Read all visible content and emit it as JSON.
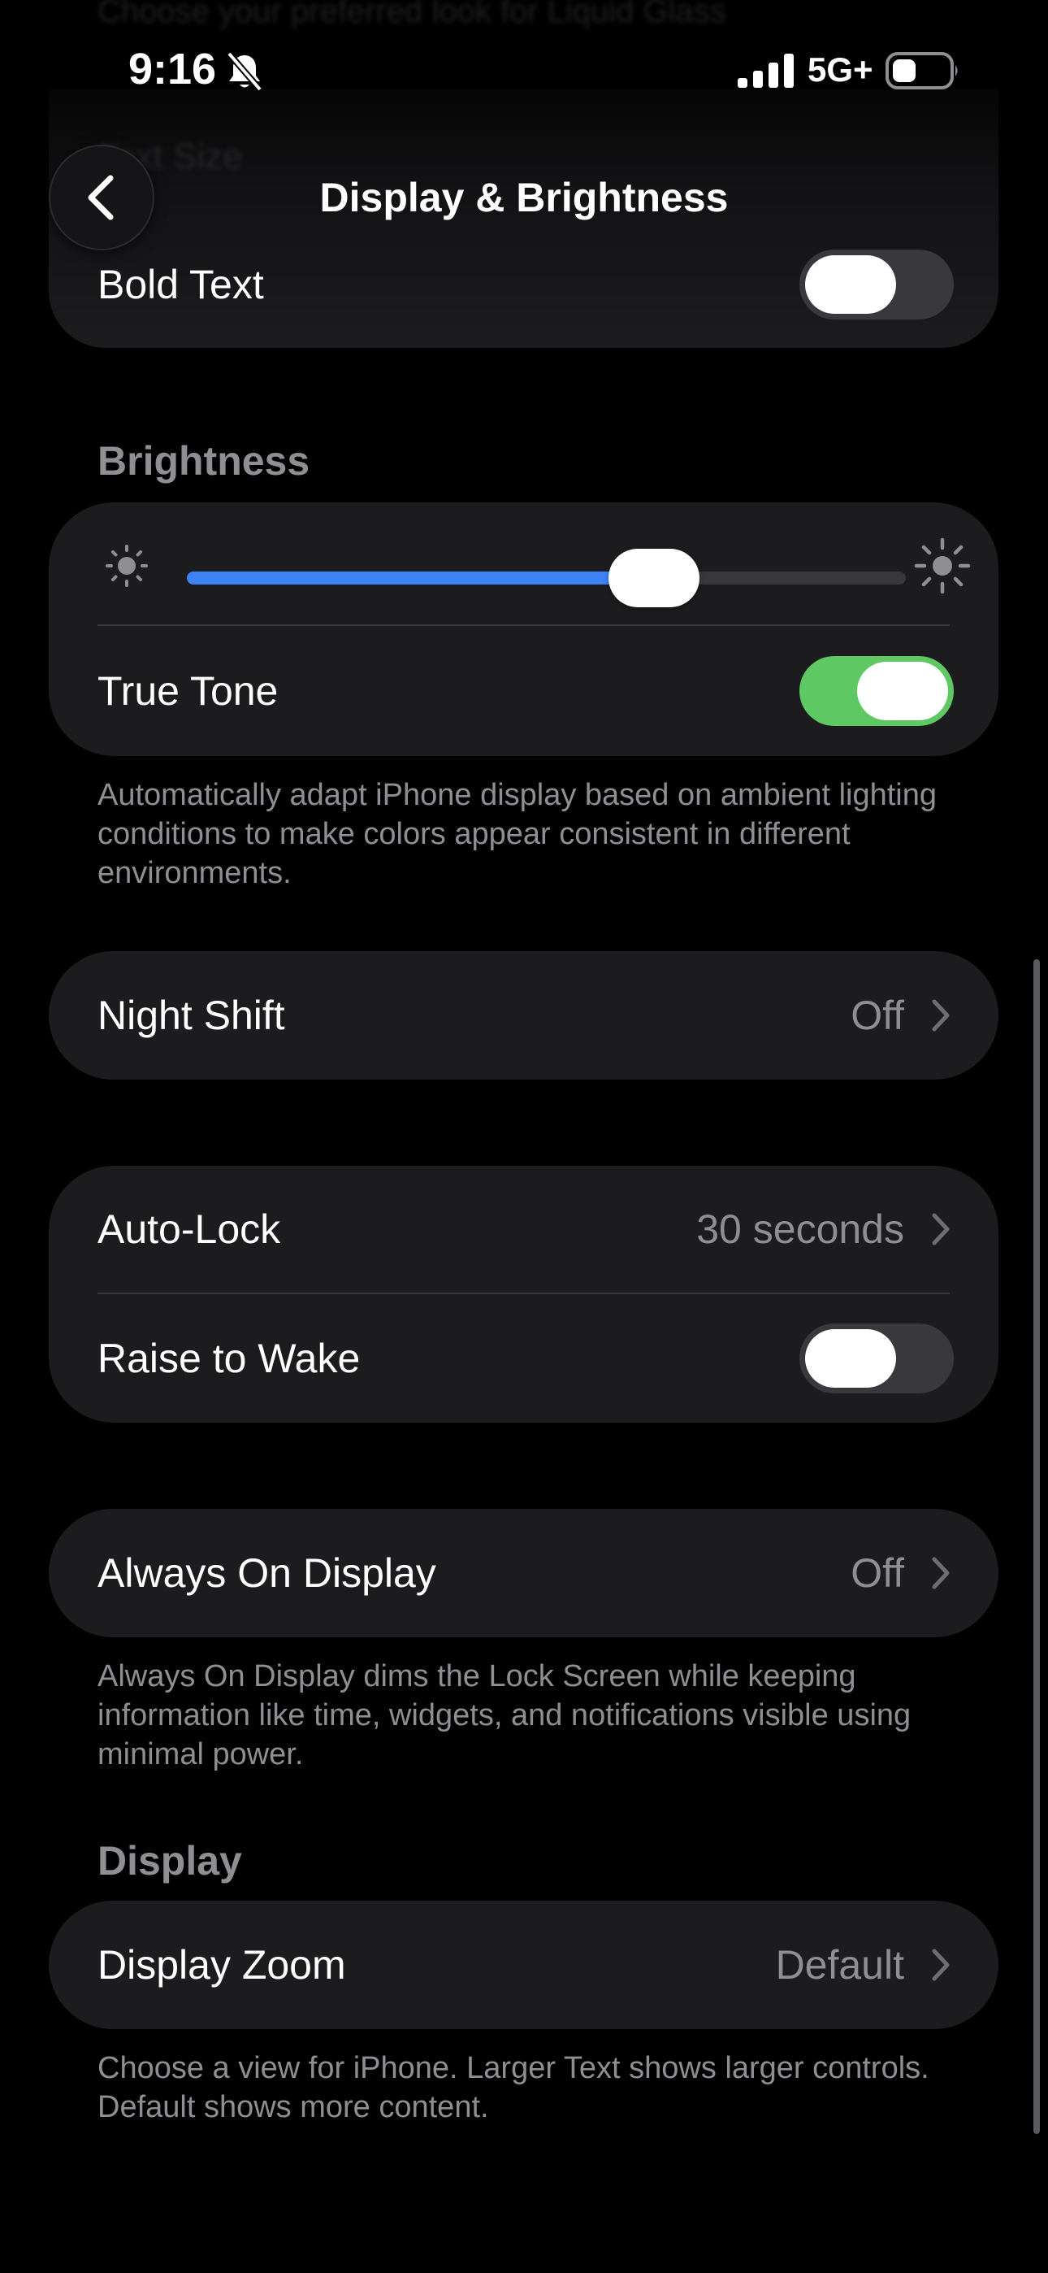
{
  "status_bar": {
    "time": "9:16",
    "network": "5G+"
  },
  "nav": {
    "title": "Display & Brightness"
  },
  "scrolled": {
    "top_hint": "Choose your preferred look for Liquid Glass",
    "text_size_label": "Text Size"
  },
  "text_group": {
    "bold_text_label": "Bold Text",
    "bold_text_on": false
  },
  "brightness": {
    "header": "Brightness",
    "level_percent": 65,
    "true_tone_label": "True Tone",
    "true_tone_on": true,
    "footer": "Automatically adapt iPhone display based on ambient lighting conditions to make colors appear consistent in different environments."
  },
  "night_shift": {
    "label": "Night Shift",
    "value": "Off"
  },
  "lock_group": {
    "auto_lock_label": "Auto-Lock",
    "auto_lock_value": "30 seconds",
    "raise_to_wake_label": "Raise to Wake",
    "raise_to_wake_on": false
  },
  "always_on": {
    "label": "Always On Display",
    "value": "Off",
    "footer": "Always On Display dims the Lock Screen while keeping information like time, widgets, and notifications visible using minimal power."
  },
  "display": {
    "header": "Display",
    "zoom_label": "Display Zoom",
    "zoom_value": "Default",
    "footer": "Choose a view for iPhone. Larger Text shows larger controls. Default shows more content."
  },
  "colors": {
    "background": "#000000",
    "card": "#1c1c1e",
    "toggle_on": "#5ec962",
    "slider_fill": "#3d82f6",
    "secondary_text": "#8e8e93"
  },
  "icons": {
    "back": "chevron-left-icon",
    "silent": "bell-slash-icon",
    "signal": "cellular-signal-icon",
    "battery": "battery-icon",
    "disclosure": "chevron-right-icon",
    "brightness_low": "sun-small-icon",
    "brightness_high": "sun-large-icon"
  }
}
